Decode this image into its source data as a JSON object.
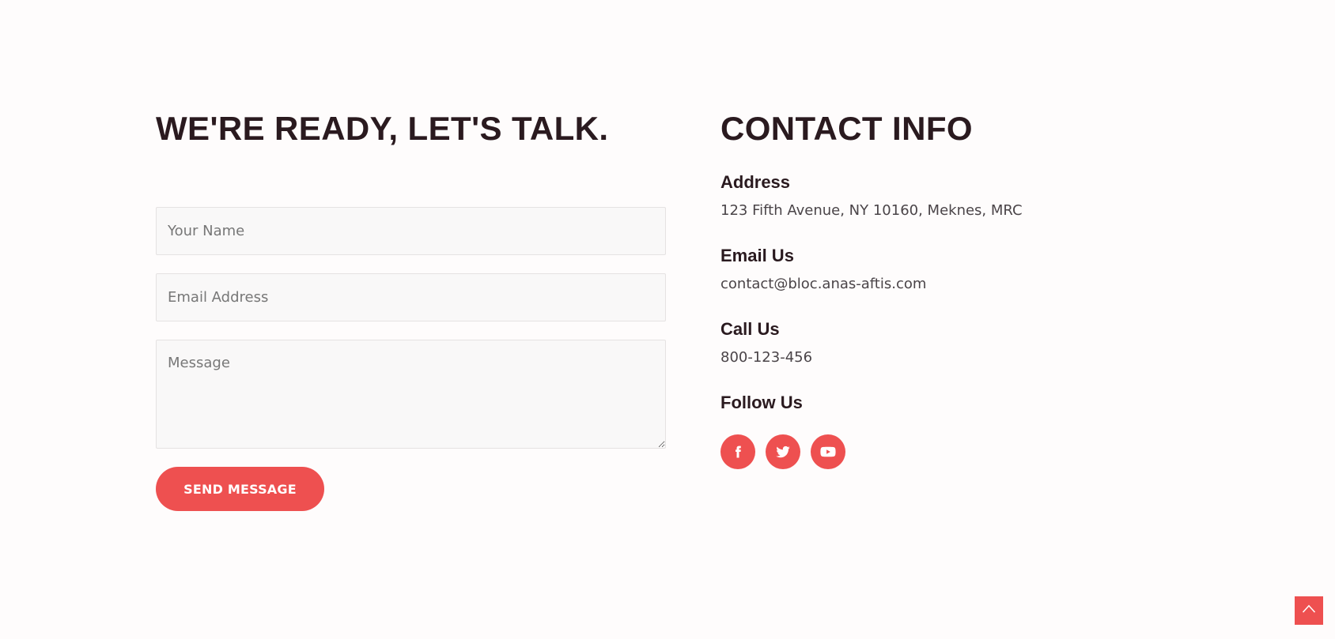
{
  "form": {
    "heading": "WE'RE READY, LET'S TALK.",
    "name_placeholder": "Your Name",
    "email_placeholder": "Email Address",
    "message_placeholder": "Message",
    "send_label": "SEND MESSAGE"
  },
  "contact": {
    "heading": "CONTACT INFO",
    "address_label": "Address",
    "address_value": "123 Fifth Avenue, NY 10160, Meknes, MRC",
    "email_label": "Email Us",
    "email_value": "contact@bloc.anas-aftis.com",
    "call_label": "Call Us",
    "call_value": "800-123-456",
    "follow_label": "Follow Us",
    "social": [
      {
        "icon": "facebook-icon"
      },
      {
        "icon": "twitter-icon"
      },
      {
        "icon": "youtube-icon"
      }
    ]
  },
  "scroll_top": {
    "icon": "chevron-up-icon"
  },
  "colors": {
    "accent": "#ee5050",
    "heading": "#2a1a1f",
    "body_text": "#4a4448",
    "field_bg": "#f9f8f8",
    "page_bg": "#fefcfc"
  }
}
